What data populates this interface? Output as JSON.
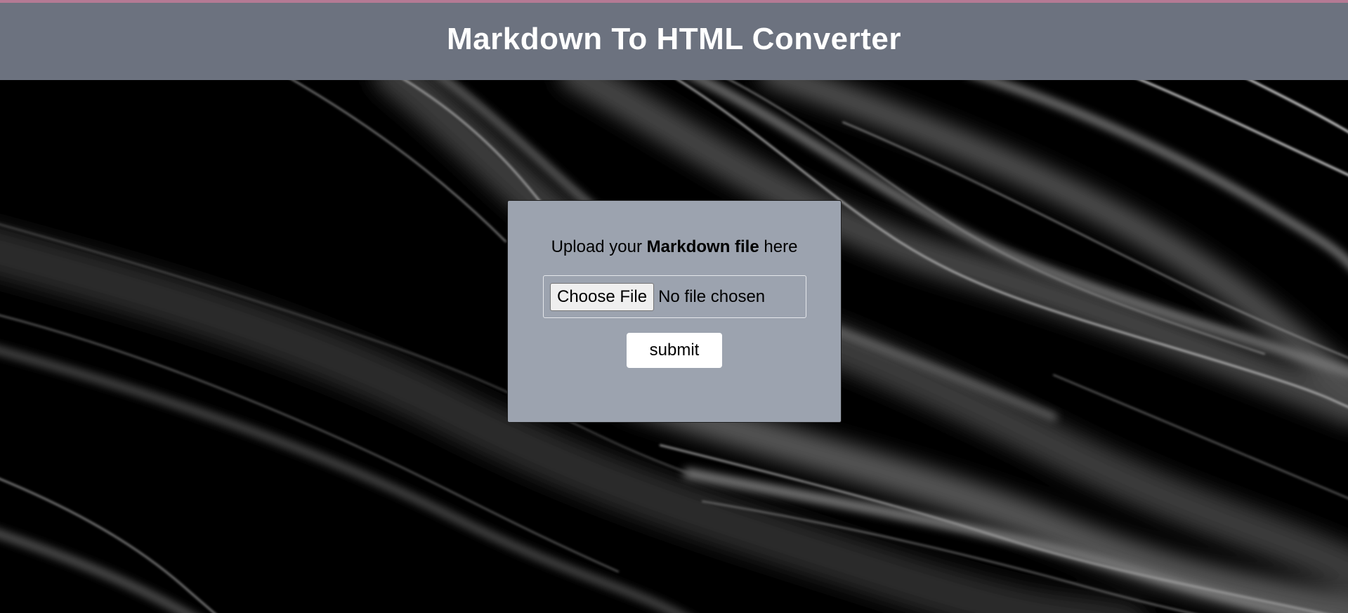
{
  "header": {
    "title": "Markdown To HTML Converter"
  },
  "form": {
    "prompt_prefix": "Upload your",
    "prompt_bold": "Markdown file",
    "prompt_suffix": "here",
    "choose_file_label": "Choose File",
    "file_status": "No file chosen",
    "submit_label": "submit"
  },
  "colors": {
    "top_stripe": "#b57a94",
    "header_bg": "#6c727f",
    "card_bg": "#9ca3af",
    "page_bg": "#000000"
  }
}
